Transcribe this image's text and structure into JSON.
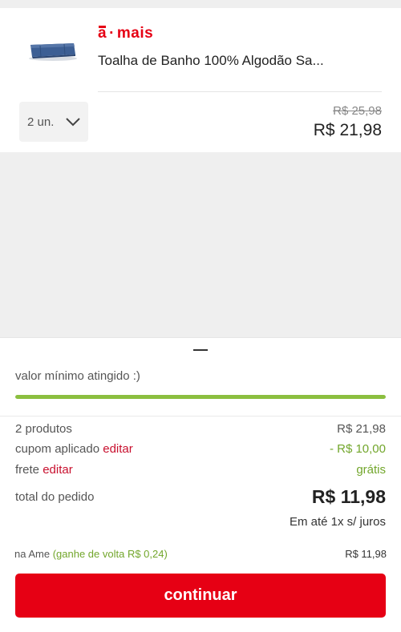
{
  "product": {
    "brand": {
      "a": "a",
      "rest": "mais",
      "dot": "·"
    },
    "name": "Toalha de Banho 100% Algodão Sa...",
    "thumbnail_icon": "blue-towel-image",
    "quantity": "2 un.",
    "price_old": "R$ 25,98",
    "price_new": "R$ 21,98"
  },
  "summary": {
    "min_value_text": "valor mínimo atingido :)",
    "progress_fraction": 1.0,
    "products_label": "2 produtos",
    "products_value": "R$ 21,98",
    "coupon_label": "cupom aplicado",
    "coupon_edit": "editar",
    "coupon_value": "- R$ 10,00",
    "shipping_label": "frete",
    "shipping_edit": "editar",
    "shipping_value": "grátis",
    "total_label": "total do pedido",
    "total_value": "R$ 11,98",
    "installments": "Em até 1x s/ juros",
    "ame_label": "na Ame",
    "ame_cashback": "(ganhe de volta R$ 0,24)",
    "ame_value": "R$ 11,98",
    "continue_label": "continuar"
  },
  "colors": {
    "brand_red": "#e60014",
    "edit_red": "#c8102e",
    "success_green": "#72a62b",
    "progress_green": "#8bbf3f"
  }
}
